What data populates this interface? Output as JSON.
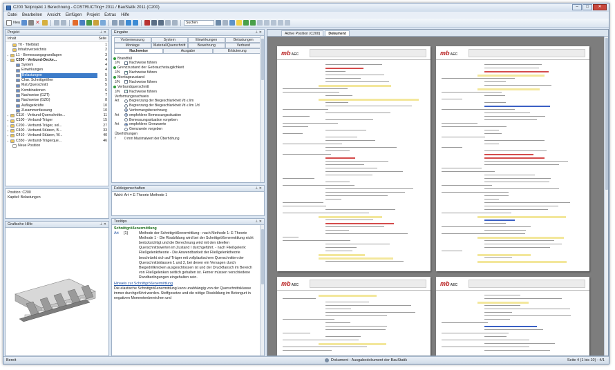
{
  "window": {
    "title": "C200 Teilprojekt 1 Berechnung - COSTRUCTing+ 2011 / BauStatik 2011 (C200)"
  },
  "menu": [
    "Datei",
    "Bearbeiten",
    "Ansicht",
    "Einfügen",
    "Projekt",
    "Extras",
    "Hilfe"
  ],
  "toolbar": {
    "new_label": "Neu",
    "search_placeholder": "Suchen"
  },
  "project_panel": {
    "title": "Projekt",
    "col_inhalt": "Inhalt",
    "col_seite": "Seite",
    "items": [
      {
        "label": "T0 - Titelblatt",
        "page": "1"
      },
      {
        "label": "Inhaltsverzeichnis",
        "page": "2"
      },
      {
        "label": "L1 - Bemessungsgrundlagen",
        "page": "3"
      },
      {
        "label": "C200 - Verbund-Decke...",
        "page": "4"
      },
      {
        "label": "System",
        "page": "4"
      },
      {
        "label": "Einwirkungen",
        "page": "4"
      },
      {
        "label": "Belastungen",
        "page": "5"
      },
      {
        "label": "Char. Schnittgrößen",
        "page": "5"
      },
      {
        "label": "Mat./Querschnitt",
        "page": "5"
      },
      {
        "label": "Kombinationen",
        "page": "6"
      },
      {
        "label": "Nachweise (GZT)",
        "page": "7"
      },
      {
        "label": "Nachweise (GZG)",
        "page": "8"
      },
      {
        "label": "Auflagerkräfte",
        "page": "10"
      },
      {
        "label": "Zusammenfassung",
        "page": "10"
      },
      {
        "label": "C110 - Verbund-Querschnitte...",
        "page": "11"
      },
      {
        "label": "C100 - Verbund-Träger",
        "page": "15"
      },
      {
        "label": "C200 - Verbund-Träger, sol...",
        "page": "27"
      },
      {
        "label": "C400 - Verbund-Stützen, B...",
        "page": "33"
      },
      {
        "label": "C410 - Verbund-Stützen, W...",
        "page": "40"
      },
      {
        "label": "C350 - Verbund-Trägerque...",
        "page": "46"
      },
      {
        "label": "Neue Position",
        "page": ""
      }
    ]
  },
  "position_info": {
    "line1": "Position: C200",
    "line2": "Kapitel: Belastungen"
  },
  "graphics_panel": {
    "title": "Grafische Hilfe"
  },
  "input_panel": {
    "title": "Eingabe",
    "tabs": [
      "Vorbemessung",
      "System",
      "Einwirkungen",
      "Belastungen",
      "Montage",
      "Material/Querschnitt",
      "Bewehrung",
      "Verbund",
      "Nachweise",
      "Ausgabe",
      "Erläuterung"
    ],
    "active_tab": "Nachweise",
    "rows": [
      {
        "kind": "sect",
        "text": "Brandfall"
      },
      {
        "kind": "chk",
        "lbl": "J/N",
        "text": "Nachweise führen",
        "on": false
      },
      {
        "kind": "sect",
        "text": "Grenzzustand der Gebrauchstauglichkeit"
      },
      {
        "kind": "chk",
        "lbl": "J/N",
        "text": "Nachweise führen",
        "on": true
      },
      {
        "kind": "sect",
        "text": "Montagezustand"
      },
      {
        "kind": "chk",
        "lbl": "J/N",
        "text": "Nachweise führen",
        "on": false
      },
      {
        "kind": "sect",
        "text": "Verbundquerschnitt"
      },
      {
        "kind": "chk",
        "lbl": "J/N",
        "text": "Nachweise führen",
        "on": true
      },
      {
        "kind": "plain",
        "lbl": "",
        "text": "Verformungsnachweis"
      },
      {
        "kind": "radio",
        "lbl": "Art",
        "text": "Begrenzung der Biegeschlankheit l/d ≤ lim",
        "on": false
      },
      {
        "kind": "radio",
        "lbl": "",
        "text": "Begrenzung der Biegeschlankheit l/d ≤ lim 1/d",
        "on": false
      },
      {
        "kind": "radio",
        "lbl": "",
        "text": "Verformungsberechnung",
        "on": true
      },
      {
        "kind": "radio",
        "lbl": "Art",
        "text": "empfohlene Bemessungssituation",
        "on": true
      },
      {
        "kind": "radio",
        "lbl": "",
        "text": "Bemessungssituation vorgeben",
        "on": false
      },
      {
        "kind": "radio",
        "lbl": "Art",
        "text": "empfohlene Grenzwerte",
        "on": true
      },
      {
        "kind": "radio",
        "lbl": "",
        "text": "Grenzwerte vorgeben",
        "on": false
      },
      {
        "kind": "plain",
        "lbl": "",
        "text": "Überhöhungen"
      },
      {
        "kind": "plain",
        "lbl": "f",
        "text": "         0  mm      Maximalwert der Überhöhung"
      }
    ]
  },
  "field_props": {
    "title": "Feldeigenschaften",
    "text": "Wahl: Art = E-Theorie Methode 1"
  },
  "hints_panel": {
    "title": "Tooltips",
    "heading": "Schnittgrößenermittlung",
    "sub_label": "Art",
    "sub_value": "[1]",
    "body": "Methode der Schnittgrößenermittlung - nach Methode 1: E-Theorie Methode 1 - Die Rissbildung wird bei der Schnittgrößenermittlung nicht berücksichtigt und die Berechnung wird mit den ideellen Querschnittswerten im Zustand I durchgeführt. - nach Fließgelenk: Fließgelenktheorie - Die Anwendbarkeit der Fließgelenktheorie beschränkt sich auf Träger mit vollplastischem Querschnitten der Querschnittsklassen 1 und 2, bei denen ein Versagen durch Biegedrillknicken ausgeschlossen ist und der Druckflansch im Bereich von Fließgelenken seitlich gehalten ist. Ferner müssen verschiedene Randbedingungen eingehalten sein.",
    "link": "Hinweis zur Schnittgrößenermittlung",
    "footer": "Die elastische Schnittgrößenermittlung kann unabhängig von der Querschnittsklasse immer durchgeführt werden. Stoffgesetze und die nötige Rissbildung im Betongurt in negativen Momentenbereichen und"
  },
  "doc_tabs": [
    "Aktive Position (C200)",
    "Dokument"
  ],
  "active_doc_tab": "Dokument",
  "status": {
    "left": "Bereit",
    "center": "Dokument - Ausgabedokument der BauStatik",
    "right": "Seite 4 (1 bis 10) - 4/1"
  },
  "page_logo": "mb",
  "page_logo_sub": "AEC"
}
